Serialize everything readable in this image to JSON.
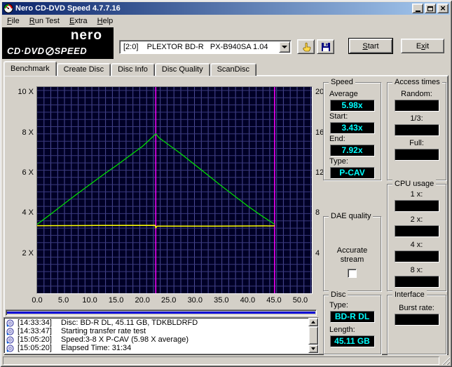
{
  "theme": {
    "chrome": "#d4d0c8",
    "titlebar_start": "#0a246a",
    "titlebar_end": "#a6caf0",
    "value_bg": "#000000",
    "value_color": "#00ffff"
  },
  "window": {
    "title": "Nero CD-DVD Speed 4.7.7.16"
  },
  "menu": {
    "items": [
      {
        "pre": "",
        "u": "F",
        "post": "ile"
      },
      {
        "pre": "",
        "u": "R",
        "post": "un Test"
      },
      {
        "pre": "",
        "u": "E",
        "post": "xtra"
      },
      {
        "pre": "",
        "u": "H",
        "post": "elp"
      }
    ]
  },
  "logo": {
    "brand": "nero",
    "product_left": "CD·DVD",
    "product_right": "SPEED"
  },
  "toolbar": {
    "drive": "[2:0]    PLEXTOR BD-R   PX-B940SA 1.04",
    "start": {
      "pre": "",
      "u": "S",
      "post": "tart"
    },
    "exit": {
      "pre": "E",
      "u": "x",
      "post": "it"
    }
  },
  "tabs": {
    "items": [
      {
        "label": "Benchmark"
      },
      {
        "label": "Create Disc"
      },
      {
        "label": "Disc Info"
      },
      {
        "label": "Disc Quality"
      },
      {
        "label": "ScanDisc"
      }
    ]
  },
  "panels": {
    "speed": {
      "title": "Speed",
      "rows": [
        {
          "label": "Average",
          "value": "5.98x"
        },
        {
          "label": "Start:",
          "value": "3.43x"
        },
        {
          "label": "End:",
          "value": "7.92x"
        },
        {
          "label": "Type:",
          "value": "P-CAV"
        }
      ]
    },
    "access": {
      "title": "Access times",
      "rows": [
        {
          "label": "Random:",
          "value": ""
        },
        {
          "label": "1/3:",
          "value": ""
        },
        {
          "label": "Full:",
          "value": ""
        }
      ]
    },
    "cpu": {
      "title": "CPU usage",
      "rows": [
        {
          "label": "1 x:",
          "value": ""
        },
        {
          "label": "2 x:",
          "value": ""
        },
        {
          "label": "4 x:",
          "value": ""
        },
        {
          "label": "8 x:",
          "value": ""
        }
      ]
    },
    "dae": {
      "title": "DAE quality",
      "label": "Accurate stream"
    },
    "disc": {
      "title": "Disc",
      "rows": [
        {
          "label": "Type:",
          "value": "BD-R DL"
        },
        {
          "label": "Length:",
          "value": "45.11 GB"
        }
      ]
    },
    "interface": {
      "title": "Interface",
      "rows": [
        {
          "label": "Burst rate:",
          "value": ""
        }
      ]
    }
  },
  "log": {
    "entries": [
      {
        "time": "[14:33:34]",
        "text": "Disc: BD-R DL, 45.11 GB, TDKBLDRFD"
      },
      {
        "time": "[14:33:47]",
        "text": "Starting transfer rate test"
      },
      {
        "time": "[15:05:20]",
        "text": "Speed:3-8 X P-CAV (5.98 X average)"
      },
      {
        "time": "[15:05:20]",
        "text": "Elapsed Time: 31:34"
      }
    ]
  },
  "progress": {
    "value_percent": 100,
    "color": "#0000d4"
  },
  "chart_data": {
    "type": "line",
    "title": "",
    "xlabel": "",
    "ylabel": "",
    "xlim": [
      0,
      52.2
    ],
    "ylim_left": [
      0,
      10.25
    ],
    "ylim_right": [
      0,
      20.5
    ],
    "x_ticks": [
      {
        "v": 0,
        "label": "0.0"
      },
      {
        "v": 5,
        "label": "5.0"
      },
      {
        "v": 10,
        "label": "10.0"
      },
      {
        "v": 15,
        "label": "15.0"
      },
      {
        "v": 20,
        "label": "20.0"
      },
      {
        "v": 25,
        "label": "25.0"
      },
      {
        "v": 30,
        "label": "30.0"
      },
      {
        "v": 35,
        "label": "35.0"
      },
      {
        "v": 40,
        "label": "40.0"
      },
      {
        "v": 45,
        "label": "45.0"
      },
      {
        "v": 50,
        "label": "50.0"
      }
    ],
    "left_ticks": [
      {
        "v": 10,
        "label": "10 X"
      },
      {
        "v": 8,
        "label": "8 X"
      },
      {
        "v": 6,
        "label": "6 X"
      },
      {
        "v": 4,
        "label": "4 X"
      },
      {
        "v": 2,
        "label": "2 X"
      }
    ],
    "right_ticks": [
      {
        "v": 10,
        "label": "20"
      },
      {
        "v": 8,
        "label": "16"
      },
      {
        "v": 6,
        "label": "12"
      },
      {
        "v": 4,
        "label": "8"
      },
      {
        "v": 2,
        "label": "4"
      }
    ],
    "grid": {
      "bg": "#000026",
      "v_step": 1.3,
      "h_step": 0.36,
      "v_color": "#4b4b96",
      "h_color": "#3a3a7d"
    },
    "vlines": [
      {
        "x": 22.55,
        "color": "#ff00ff"
      },
      {
        "x": 45.11,
        "color": "#ff00ff"
      }
    ],
    "series": [
      {
        "name": "read-speed",
        "color": "#00e800",
        "width": 1.2,
        "points": [
          [
            0,
            3.43
          ],
          [
            2.5,
            3.92
          ],
          [
            5,
            4.42
          ],
          [
            7.5,
            4.92
          ],
          [
            10,
            5.4
          ],
          [
            12.5,
            5.88
          ],
          [
            15,
            6.34
          ],
          [
            17.5,
            6.82
          ],
          [
            20,
            7.3
          ],
          [
            22.4,
            7.88
          ],
          [
            22.55,
            7.92
          ],
          [
            23.2,
            7.72
          ],
          [
            25,
            7.38
          ],
          [
            27.5,
            6.9
          ],
          [
            30,
            6.38
          ],
          [
            32.5,
            5.86
          ],
          [
            35,
            5.34
          ],
          [
            37.5,
            4.84
          ],
          [
            40,
            4.34
          ],
          [
            42.5,
            3.88
          ],
          [
            45.11,
            3.43
          ]
        ]
      },
      {
        "name": "rotation-speed",
        "color": "#ffff00",
        "width": 1.5,
        "points": [
          [
            0,
            3.36
          ],
          [
            11,
            3.37
          ],
          [
            22.4,
            3.38
          ],
          [
            22.55,
            3.26
          ],
          [
            22.8,
            3.34
          ],
          [
            34,
            3.34
          ],
          [
            45.11,
            3.35
          ]
        ]
      }
    ]
  }
}
